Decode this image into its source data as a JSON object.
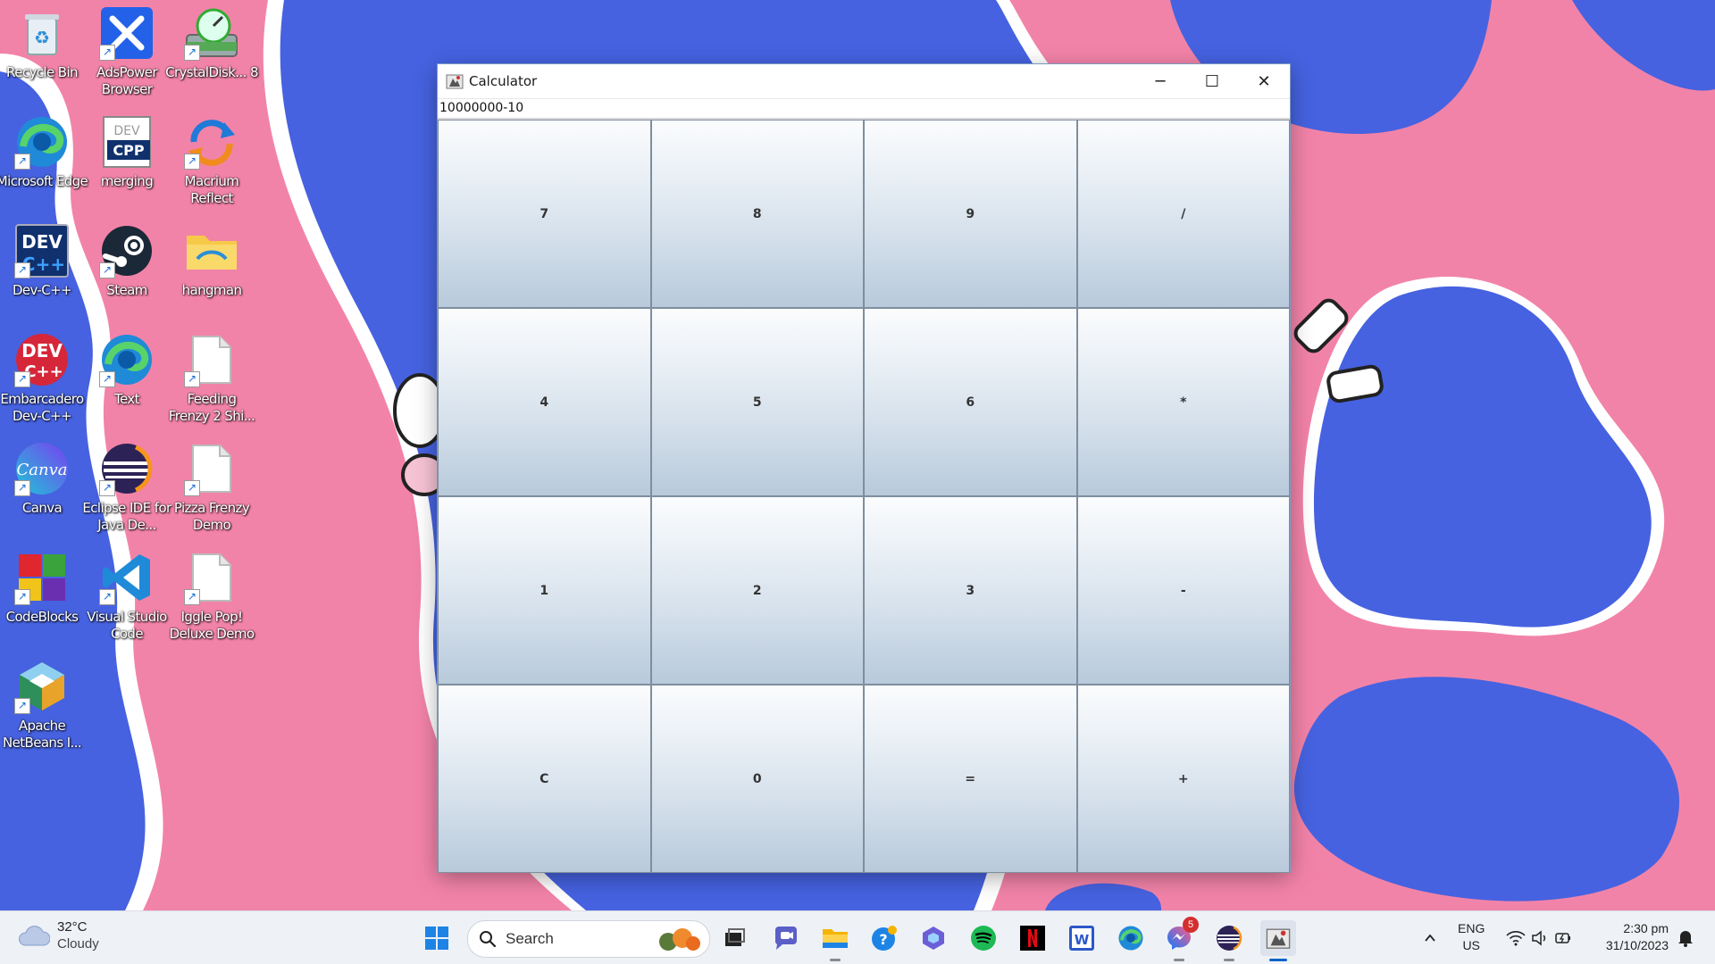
{
  "desktop": {
    "icons": [
      {
        "label": "Recycle Bin",
        "icon": "recycle-bin-icon"
      },
      {
        "label": "AdsPower Browser",
        "icon": "adspower-icon"
      },
      {
        "label": "CrystalDisk... 8",
        "icon": "crystaldisk-icon"
      },
      {
        "label": "Microsoft Edge",
        "icon": "edge-icon"
      },
      {
        "label": "merging",
        "icon": "cpp-file-icon"
      },
      {
        "label": "Macrium Reflect",
        "icon": "macrium-icon"
      },
      {
        "label": "Dev-C++",
        "icon": "devcpp-icon"
      },
      {
        "label": "Steam",
        "icon": "steam-icon"
      },
      {
        "label": "hangman",
        "icon": "folder-icon"
      },
      {
        "label": "Embarcadero Dev-C++",
        "icon": "embarcadero-icon"
      },
      {
        "label": "Text",
        "icon": "edge-icon"
      },
      {
        "label": "Feeding Frenzy 2 Shi...",
        "icon": "file-icon"
      },
      {
        "label": "Canva",
        "icon": "canva-icon"
      },
      {
        "label": "Eclipse IDE for Java De...",
        "icon": "eclipse-icon"
      },
      {
        "label": "Pizza Frenzy Demo",
        "icon": "file-icon"
      },
      {
        "label": "CodeBlocks",
        "icon": "codeblocks-icon"
      },
      {
        "label": "Visual Studio Code",
        "icon": "vscode-icon"
      },
      {
        "label": "Iggle Pop! Deluxe Demo",
        "icon": "file-icon"
      },
      {
        "label": "Apache NetBeans I...",
        "icon": "netbeans-icon"
      }
    ]
  },
  "window": {
    "title": "Calculator",
    "minimize": "─",
    "maximize": "☐",
    "close": "✕",
    "display_value": "10000000-10",
    "keys": [
      "7",
      "8",
      "9",
      "/",
      "4",
      "5",
      "6",
      "*",
      "1",
      "2",
      "3",
      "-",
      "C",
      "0",
      "=",
      "+"
    ]
  },
  "taskbar": {
    "weather": {
      "temp": "32°C",
      "condition": "Cloudy",
      "icon": "cloud-icon"
    },
    "search_placeholder": "Search",
    "apps": [
      "start-icon",
      "task-view-icon",
      "chat-icon",
      "file-explorer-icon",
      "tips-icon",
      "copilot-icon",
      "spotify-icon",
      "netflix-icon",
      "word-icon",
      "edge-icon",
      "messenger-icon",
      "eclipse-icon",
      "calculator-app-icon"
    ],
    "messenger_badge": "5",
    "lang_top": "ENG",
    "lang_bottom": "US",
    "time": "2:30 pm",
    "date": "31/10/2023"
  },
  "colors": {
    "wallpaper_pink": "#f283a8",
    "wallpaper_blue": "#4662e0",
    "key_gradient_top": "#fbfcfd",
    "key_gradient_bottom": "#b8cadb"
  }
}
